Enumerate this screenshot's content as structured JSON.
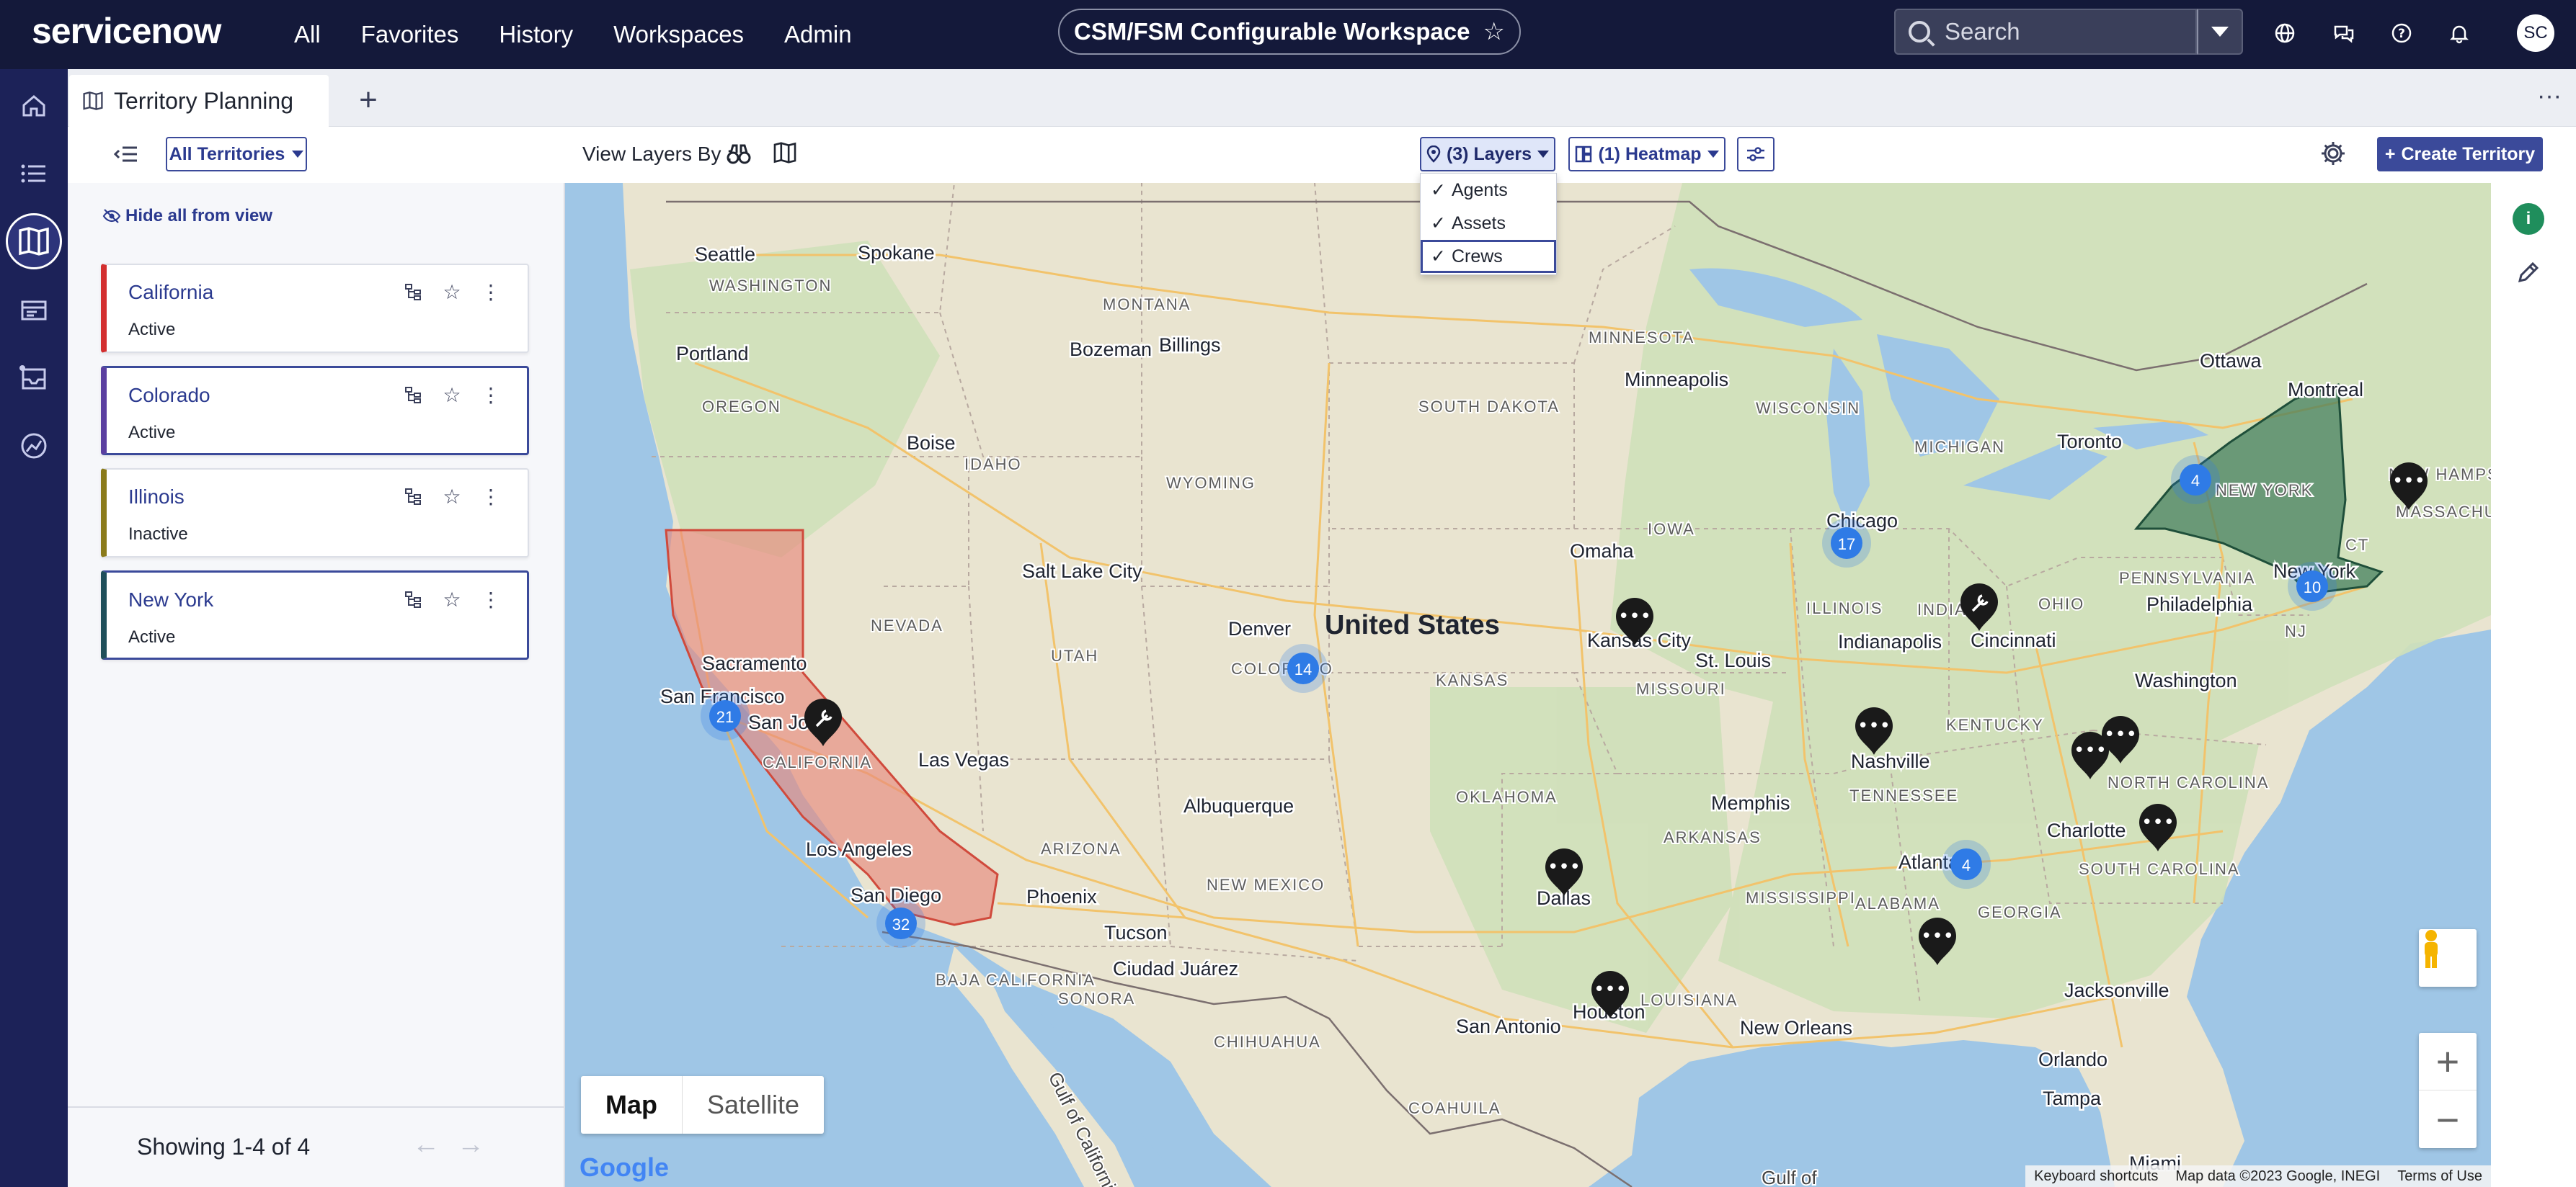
{
  "topbar": {
    "logo": "servicenow",
    "nav": [
      "All",
      "Favorites",
      "History",
      "Workspaces",
      "Admin"
    ],
    "workspace_title": "CSM/FSM Configurable Workspace",
    "search_placeholder": "Search",
    "avatar_initials": "SC"
  },
  "tab": {
    "title": "Territory Planning"
  },
  "toolbar": {
    "all_territories": "All Territories",
    "view_layers_by": "View Layers By :",
    "layers_label": "(3) Layers",
    "heatmap_label": "(1) Heatmap",
    "create_label": "Create Territory"
  },
  "layers_menu": {
    "items": [
      {
        "label": "Agents",
        "checked": true
      },
      {
        "label": "Assets",
        "checked": true
      },
      {
        "label": "Crews",
        "checked": true
      }
    ]
  },
  "panel": {
    "hide_all": "Hide all from view",
    "territories": [
      {
        "name": "California",
        "status": "Active",
        "color": "#d32f2f",
        "selected": false
      },
      {
        "name": "Colorado",
        "status": "Active",
        "color": "#5a3fa0",
        "selected": true
      },
      {
        "name": "Illinois",
        "status": "Inactive",
        "color": "#8a7a1a",
        "selected": false
      },
      {
        "name": "New York",
        "status": "Active",
        "color": "#1f4f5a",
        "selected": true
      }
    ],
    "showing": "Showing 1-4 of 4"
  },
  "map": {
    "type_map": "Map",
    "type_satellite": "Satellite",
    "country_label": "United States",
    "cities": [
      "Seattle",
      "Spokane",
      "Portland",
      "Boise",
      "Bozeman",
      "Billings",
      "Salt Lake City",
      "Sacramento",
      "San Francisco",
      "San Jose",
      "Las Vegas",
      "Los Angeles",
      "San Diego",
      "Phoenix",
      "Tucson",
      "Ciudad Juárez",
      "Albuquerque",
      "Denver",
      "Minneapolis",
      "Omaha",
      "Kansas City",
      "St. Louis",
      "Chicago",
      "Indianapolis",
      "Cincinnati",
      "Toronto",
      "Ottawa",
      "Montreal",
      "New York",
      "Philadelphia",
      "Washington",
      "Nashville",
      "Memphis",
      "Charlotte",
      "Atlanta",
      "Dallas",
      "Houston",
      "San Antonio",
      "New Orleans",
      "Jacksonville",
      "Orlando",
      "Tampa",
      "Miami"
    ],
    "states": [
      "WASHINGTON",
      "MONTANA",
      "IDAHO",
      "WYOMING",
      "NEVADA",
      "UTAH",
      "COLORADO",
      "CALIFORNIA",
      "ARIZONA",
      "NEW MEXICO",
      "SOUTH DAKOTA",
      "MINNESOTA",
      "WISCONSIN",
      "IOWA",
      "MICHIGAN",
      "ILLINOIS",
      "INDIANA",
      "OHIO",
      "KANSAS",
      "MISSOURI",
      "KENTUCKY",
      "TENNESSEE",
      "OKLAHOMA",
      "ARKANSAS",
      "MISSISSIPPI",
      "ALABAMA",
      "GEORGIA",
      "LOUISIANA",
      "NORTH CAROLINA",
      "SOUTH CAROLINA",
      "PENNSYLVANIA",
      "NEW YORK",
      "NJ",
      "CT",
      "NEW HAMPSHIRE",
      "MASSACHUSETTS",
      "BAJA CALIFORNIA",
      "SONORA",
      "CHIHUAHUA",
      "COAHUILA",
      "OREGON"
    ],
    "clusters": [
      "21",
      "32",
      "14",
      "17",
      "4",
      "10",
      "4"
    ],
    "keyboard_shortcuts": "Keyboard shortcuts",
    "map_data": "Map data ©2023 Google, INEGI",
    "terms": "Terms of Use",
    "google": "Google",
    "water_label": "Gulf of California",
    "water_label_2": "Gulf of"
  },
  "colors": {
    "nav_bg": "#14193a",
    "rail_bg": "#1c2258",
    "accent": "#3b4a9a",
    "california_fill": "#e8897c",
    "newyork_fill": "#3d7a5a",
    "cluster": "#2f7be6"
  }
}
